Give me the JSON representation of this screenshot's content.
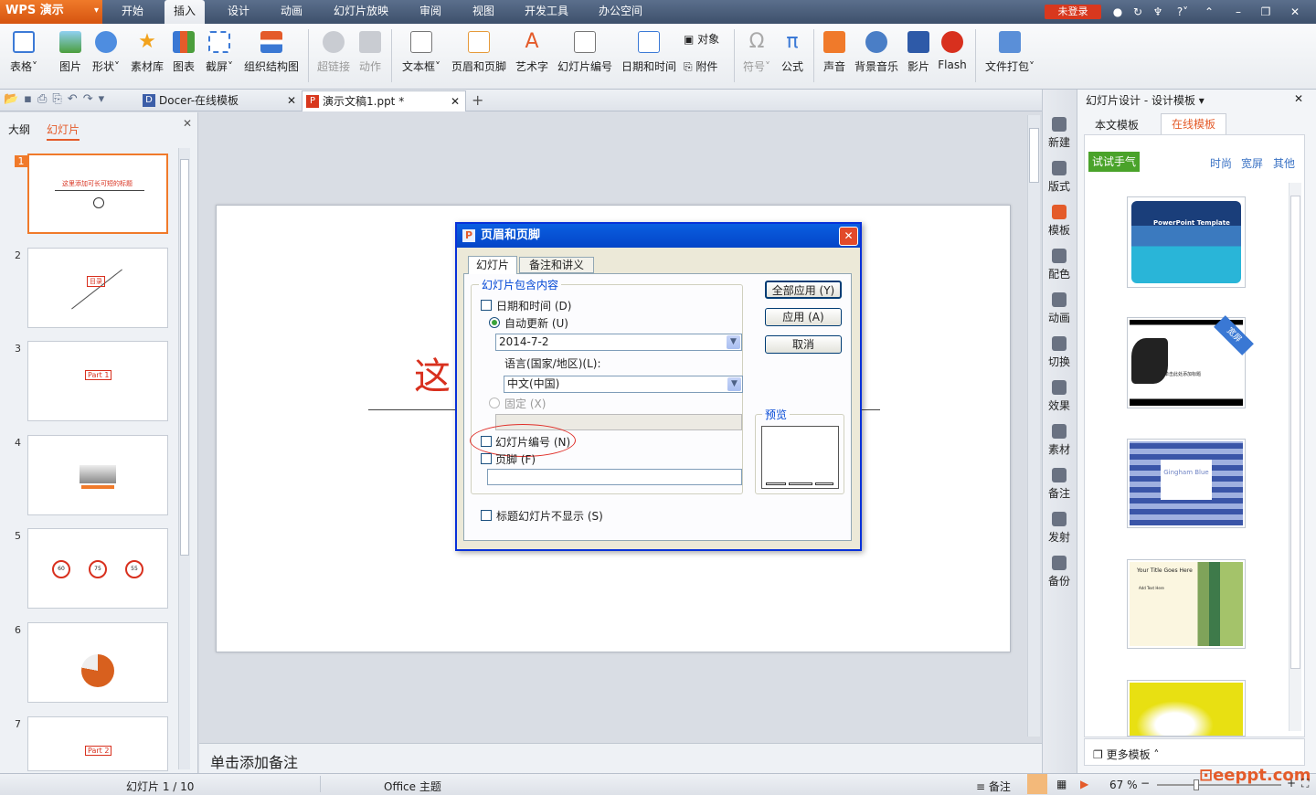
{
  "app": {
    "name": "WPS 演示",
    "login": "未登录"
  },
  "menu_tabs": [
    "开始",
    "插入",
    "设计",
    "动画",
    "幻灯片放映",
    "审阅",
    "视图",
    "开发工具",
    "办公空间"
  ],
  "ribbon": {
    "table": "表格",
    "picture": "图片",
    "shape": "形状",
    "material": "素材库",
    "chart": "图表",
    "screenshot": "截屏",
    "org_chart": "组织结构图",
    "hyperlink": "超链接",
    "action": "动作",
    "textbox": "文本框",
    "header_footer": "页眉和页脚",
    "wordart": "艺术字",
    "slide_number": "幻灯片编号",
    "datetime": "日期和时间",
    "object": "对象",
    "attachment": "附件",
    "symbol": "符号",
    "formula": "公式",
    "sound": "声音",
    "bg_music": "背景音乐",
    "movie": "影片",
    "flash": "Flash",
    "package": "文件打包"
  },
  "doc_tabs": [
    {
      "label": "Docer-在线模板"
    },
    {
      "label": "演示文稿1.ppt *"
    }
  ],
  "left_panel": {
    "tabs": [
      "大纲",
      "幻灯片"
    ],
    "slides": [
      "1",
      "2",
      "3",
      "4",
      "5",
      "6",
      "7"
    ],
    "thumb_texts": {
      "s1": "这里添加可长可短的标题",
      "s3": "Part 1",
      "s7": "Part 2",
      "s2": "目录",
      "s5": [
        "60",
        "75",
        "55"
      ],
      "s6": [
        "22",
        "78"
      ]
    }
  },
  "slide_title_fragment": "这",
  "notes_placeholder": "单击添加备注",
  "side_icons": [
    "新建",
    "版式",
    "模板",
    "配色",
    "动画",
    "切换",
    "效果",
    "素材",
    "备注",
    "发射",
    "备份"
  ],
  "right_panel": {
    "title": "幻灯片设计 - 设计模板",
    "tabs": [
      "本文模板",
      "在线模板"
    ],
    "try_btn": "试试手气",
    "filters": [
      "时尚",
      "宽屏",
      "其他"
    ],
    "templates": [
      {
        "name": "PowerPoint Template"
      },
      {
        "name": "宽屏",
        "caption": "单击此处添加标题"
      },
      {
        "name": "Gingham Blue"
      },
      {
        "name": "Your Title Goes Here",
        "sub": "Add Text Here"
      },
      {
        "name": ""
      }
    ],
    "more": "更多模板"
  },
  "dialog": {
    "title": "页眉和页脚",
    "tabs": [
      "幻灯片",
      "备注和讲义"
    ],
    "group": "幻灯片包含内容",
    "datetime": "日期和时间 (D)",
    "auto_update": "自动更新 (U)",
    "date_value": "2014-7-2",
    "language_label": "语言(国家/地区)(L):",
    "language_value": "中文(中国)",
    "fixed": "固定 (X)",
    "slide_number": "幻灯片编号 (N)",
    "footer": "页脚 (F)",
    "no_title": "标题幻灯片不显示 (S)",
    "apply_all": "全部应用 (Y)",
    "apply": "应用 (A)",
    "cancel": "取消",
    "preview": "预览"
  },
  "status": {
    "slide": "幻灯片 1 / 10",
    "theme": "Office 主题",
    "notes": "备注",
    "zoom": "67 %",
    "watermark": "eeppt.com"
  }
}
